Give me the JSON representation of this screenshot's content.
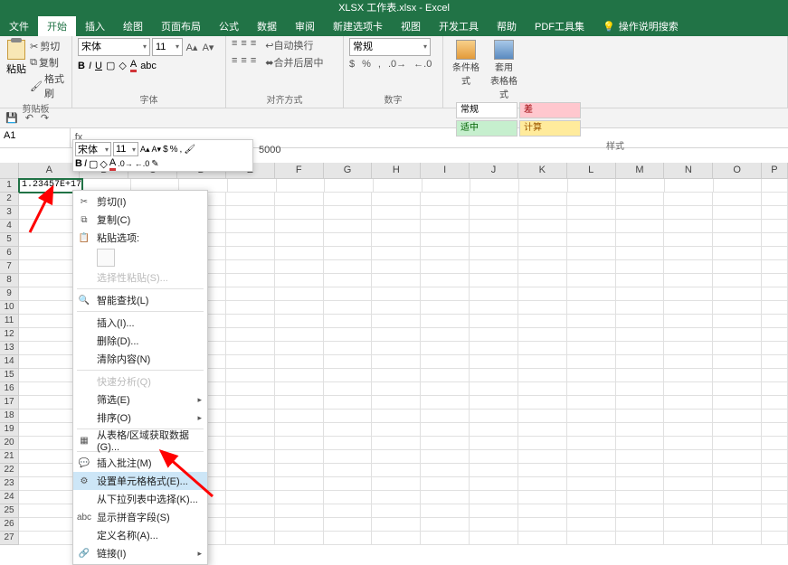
{
  "title": "XLSX 工作表.xlsx - Excel",
  "tabs": [
    "文件",
    "开始",
    "插入",
    "绘图",
    "页面布局",
    "公式",
    "数据",
    "审阅",
    "新建选项卡",
    "视图",
    "开发工具",
    "帮助",
    "PDF工具集"
  ],
  "tellme": "操作说明搜索",
  "clipboard": {
    "label": "剪贴板",
    "paste": "粘贴",
    "cut": "剪切",
    "copy": "复制",
    "fmtpainter": "格式刷"
  },
  "font": {
    "label": "字体",
    "name": "宋体",
    "size": "11"
  },
  "align": {
    "label": "对齐方式",
    "wrap": "自动换行",
    "merge": "合并后居中"
  },
  "number": {
    "label": "数字",
    "format": "常规"
  },
  "styles": {
    "label": "样式",
    "condfmt": "条件格式",
    "asTable": "套用\n表格格式",
    "cells": {
      "c1": "常规",
      "c2": "差",
      "c3": "适中",
      "c4": "计算"
    }
  },
  "namebox": "A1",
  "formula_value": "5000",
  "minibar": {
    "font": "宋体",
    "size": "11"
  },
  "cellA1": "1.23457E+17",
  "cols": {
    "A": 70,
    "B": 56,
    "C": 56,
    "D": 56,
    "E": 56,
    "F": 56,
    "G": 56,
    "H": 56,
    "I": 56,
    "J": 56,
    "K": 56,
    "L": 56,
    "M": 56,
    "N": 56,
    "O": 56,
    "P": 30
  },
  "ctx": {
    "cut": "剪切(I)",
    "copy": "复制(C)",
    "pasteopts": "粘贴选项:",
    "pastespecial": "选择性粘贴(S)...",
    "smartlookup": "智能查找(L)",
    "insert": "插入(I)...",
    "delete": "删除(D)...",
    "clear": "清除内容(N)",
    "quickanalysis": "快速分析(Q)",
    "filter": "筛选(E)",
    "sort": "排序(O)",
    "getdata": "从表格/区域获取数据(G)...",
    "insertcomment": "插入批注(M)",
    "formatcells": "设置单元格格式(E)...",
    "dropdown": "从下拉列表中选择(K)...",
    "phonetic": "显示拼音字段(S)",
    "definename": "定义名称(A)...",
    "link": "链接(I)"
  }
}
